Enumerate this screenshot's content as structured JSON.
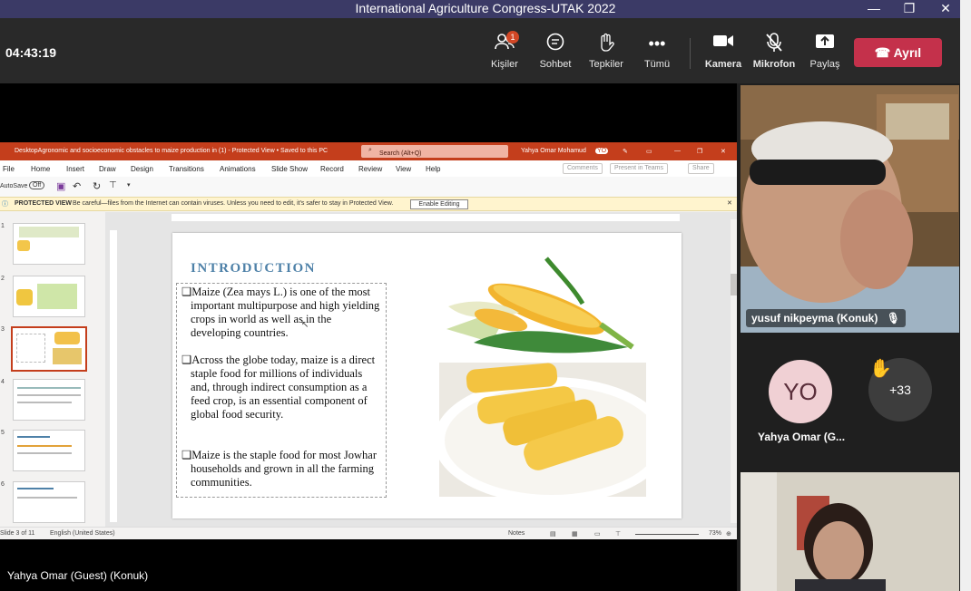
{
  "window": {
    "title": "International Agriculture Congress-UTAK 2022",
    "minimize": "—",
    "restore": "❐",
    "close": "✕"
  },
  "toolbar": {
    "clock": "04:43:19",
    "people_label": "Kişiler",
    "people_badge": "1",
    "chat_label": "Sohbet",
    "reactions_label": "Tepkiler",
    "more_label": "Tümü",
    "camera_label": "Kamera",
    "mic_label": "Mikrofon",
    "share_label": "Paylaş",
    "leave_label": "Ayrıl"
  },
  "powerpoint": {
    "doc_title": "DesktopAgronomic and socioeconomic obstacles to maize production in (1)  -  Protected View  •  Saved to this PC",
    "search_placeholder": "Search (Alt+Q)",
    "user_name": "Yahya Omar Mohamud",
    "user_initials": "YO",
    "menu": [
      "File",
      "Home",
      "Insert",
      "Draw",
      "Design",
      "Transitions",
      "Animations",
      "Slide Show",
      "Record",
      "Review",
      "View",
      "Help"
    ],
    "comments_btn": "Comments",
    "present_btn": "Present in Teams",
    "share_btn": "Share",
    "autosave_label": "AutoSave",
    "autosave_state": "Off",
    "protected_label": "PROTECTED VIEW",
    "protected_msg": "Be careful—files from the Internet can contain viruses. Unless you need to edit, it's safer to stay in Protected View.",
    "enable_editing": "Enable Editing",
    "thumb_numbers": [
      "1",
      "2",
      "3",
      "4",
      "5",
      "6"
    ],
    "slide": {
      "heading": "INTRODUCTION",
      "bullets": [
        "❑Maize (Zea mays L.) is one of the most important multipurpose and high yielding crops in world as well as in the developing countries.",
        "❑Across the globe today, maize is a direct staple food for millions of individuals and, through indirect consumption as a feed crop, is an essential component of global food security.",
        "❑Maize is the staple food for most Jowhar households and grown in all the farming communities."
      ]
    },
    "status": {
      "slide_count": "Slide 3 of 11",
      "language": "English (United States)",
      "notes": "Notes",
      "zoom": "73%"
    }
  },
  "presenter_name": "Yahya Omar (Guest) (Konuk)",
  "participants": {
    "video1_name": "yusuf nikpeyma (Konuk)",
    "yo_initials": "YO",
    "yo_name": "Yahya Omar (G...",
    "more_count": "+33"
  }
}
